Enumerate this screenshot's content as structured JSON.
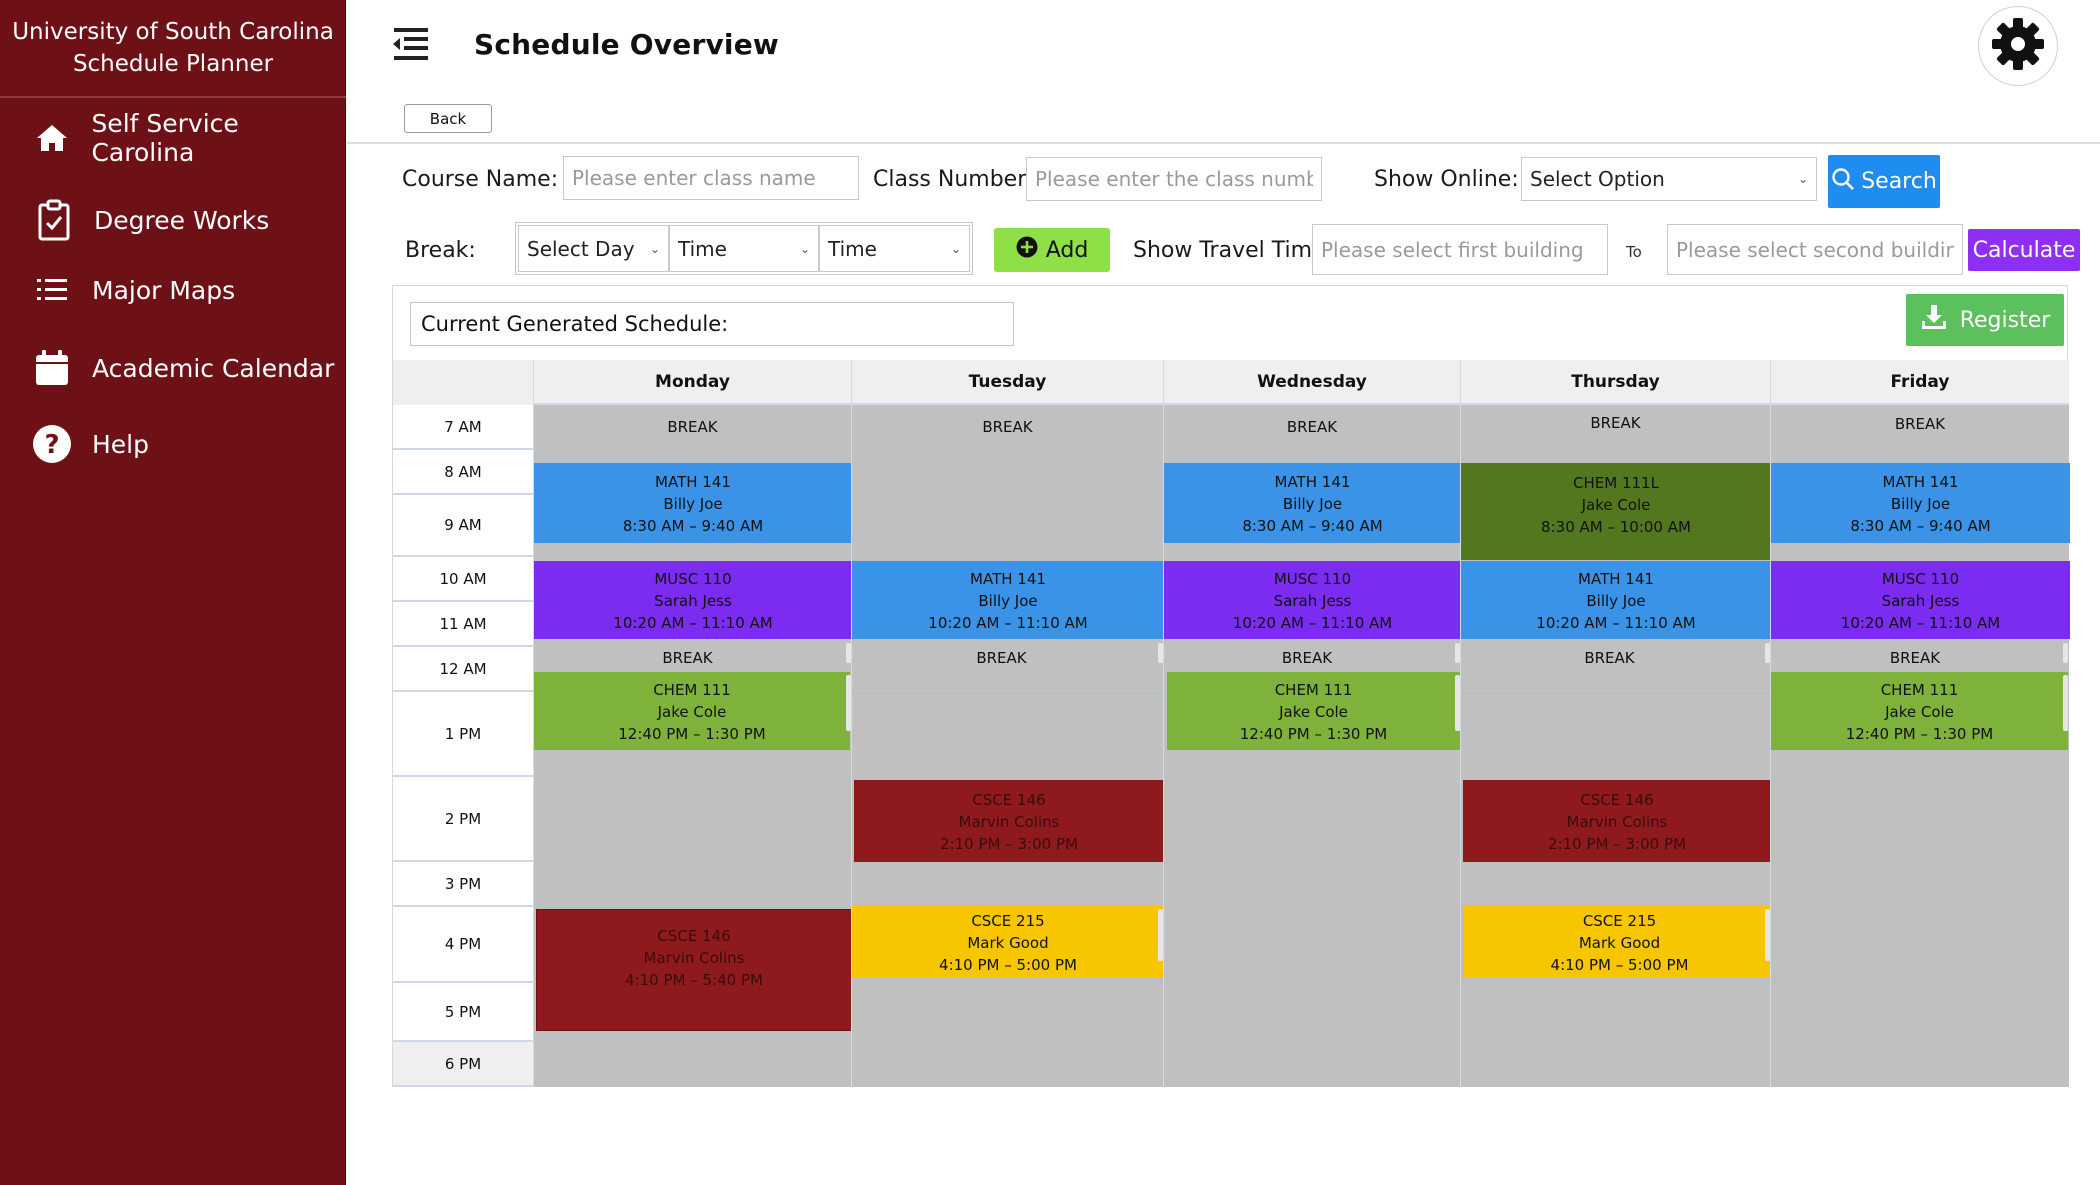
{
  "app": {
    "title_line1": "University of South Carolina",
    "title_line2": "Schedule Planner"
  },
  "sidebar": {
    "items": [
      {
        "label": "Self Service Carolina",
        "icon": "home-icon"
      },
      {
        "label": "Degree Works",
        "icon": "clipboard-check-icon"
      },
      {
        "label": "Major Maps",
        "icon": "list-icon"
      },
      {
        "label": "Academic Calendar",
        "icon": "calendar-icon"
      },
      {
        "label": "Help",
        "icon": "help-icon"
      }
    ]
  },
  "header": {
    "title": "Schedule Overview",
    "back_label": "Back"
  },
  "filters": {
    "course_name_label": "Course Name:",
    "course_name_placeholder": "Please enter class name",
    "class_number_label": "Class Number:",
    "class_number_placeholder": "Please enter the class number",
    "show_online_label": "Show Online:",
    "show_online_value": "Select Option",
    "search_label": "Search",
    "break_label": "Break:",
    "break_day_value": "Select Day",
    "break_start_value": "Time",
    "break_end_value": "Time",
    "add_label": "Add",
    "travel_label": "Show Travel Time:",
    "first_building_placeholder": "Please select first building",
    "to_label": "To",
    "second_building_placeholder": "Please select second building",
    "calculate_label": "Calculate"
  },
  "schedule": {
    "generated_label": "Current Generated Schedule:",
    "register_label": "Register",
    "times": [
      "7 AM",
      "8 AM",
      "9 AM",
      "10 AM",
      "11 AM",
      "12 AM",
      "1 PM",
      "2 PM",
      "3 PM",
      "4 PM",
      "5 PM",
      "6 PM"
    ],
    "days": [
      "Monday",
      "Tuesday",
      "Wednesday",
      "Thursday",
      "Friday"
    ],
    "break_label": "BREAK",
    "events": {
      "mon_math": {
        "course": "MATH 141",
        "instructor": "Billy Joe",
        "time": "8:30 AM – 9:40 AM"
      },
      "mon_musc": {
        "course": "MUSC 110",
        "instructor": "Sarah Jess",
        "time": "10:20 AM – 11:10 AM"
      },
      "mon_chem": {
        "course": "CHEM 111",
        "instructor": "Jake Cole",
        "time": "12:40 PM – 1:30 PM"
      },
      "mon_csce146": {
        "course": "CSCE 146",
        "instructor": "Marvin Colins",
        "time": "4:10 PM – 5:40 PM"
      },
      "tue_math": {
        "course": "MATH 141",
        "instructor": "Billy Joe",
        "time": "10:20 AM – 11:10 AM"
      },
      "tue_csce146": {
        "course": "CSCE 146",
        "instructor": "Marvin Colins",
        "time": "2:10 PM – 3:00 PM"
      },
      "tue_csce215": {
        "course": "CSCE 215",
        "instructor": "Mark Good",
        "time": "4:10 PM – 5:00 PM"
      },
      "wed_math": {
        "course": "MATH 141",
        "instructor": "Billy Joe",
        "time": "8:30 AM – 9:40 AM"
      },
      "wed_musc": {
        "course": "MUSC 110",
        "instructor": "Sarah Jess",
        "time": "10:20 AM – 11:10 AM"
      },
      "wed_chem": {
        "course": "CHEM 111",
        "instructor": "Jake Cole",
        "time": "12:40 PM – 1:30 PM"
      },
      "thu_chem111l": {
        "course": "CHEM 111L",
        "instructor": "Jake Cole",
        "time": "8:30 AM – 10:00 AM"
      },
      "thu_math": {
        "course": "MATH 141",
        "instructor": "Billy Joe",
        "time": "10:20 AM – 11:10 AM"
      },
      "thu_csce146": {
        "course": "CSCE 146",
        "instructor": "Marvin Colins",
        "time": "2:10 PM – 3:00 PM"
      },
      "thu_csce215": {
        "course": "CSCE 215",
        "instructor": "Mark Good",
        "time": "4:10 PM – 5:00 PM"
      },
      "fri_math": {
        "course": "MATH 141",
        "instructor": "Billy Joe",
        "time": "8:30 AM – 9:40 AM"
      },
      "fri_musc": {
        "course": "MUSC 110",
        "instructor": "Sarah Jess",
        "time": "10:20 AM – 11:10 AM"
      },
      "fri_chem": {
        "course": "CHEM 111",
        "instructor": "Jake Cole",
        "time": "12:40 PM – 1:30 PM"
      }
    }
  },
  "colors": {
    "sidebar_bg": "#6e1116",
    "event_blue": "#3a93e6",
    "event_purple": "#7b2cf0",
    "event_green": "#7fb23a",
    "event_olive": "#53771f",
    "event_red": "#8f1a1d",
    "event_yellow": "#f7c600",
    "search_blue": "#1e8cf0",
    "add_green": "#8ee046",
    "calculate_purple": "#8f2ef5",
    "register_green": "#5cc05c"
  }
}
